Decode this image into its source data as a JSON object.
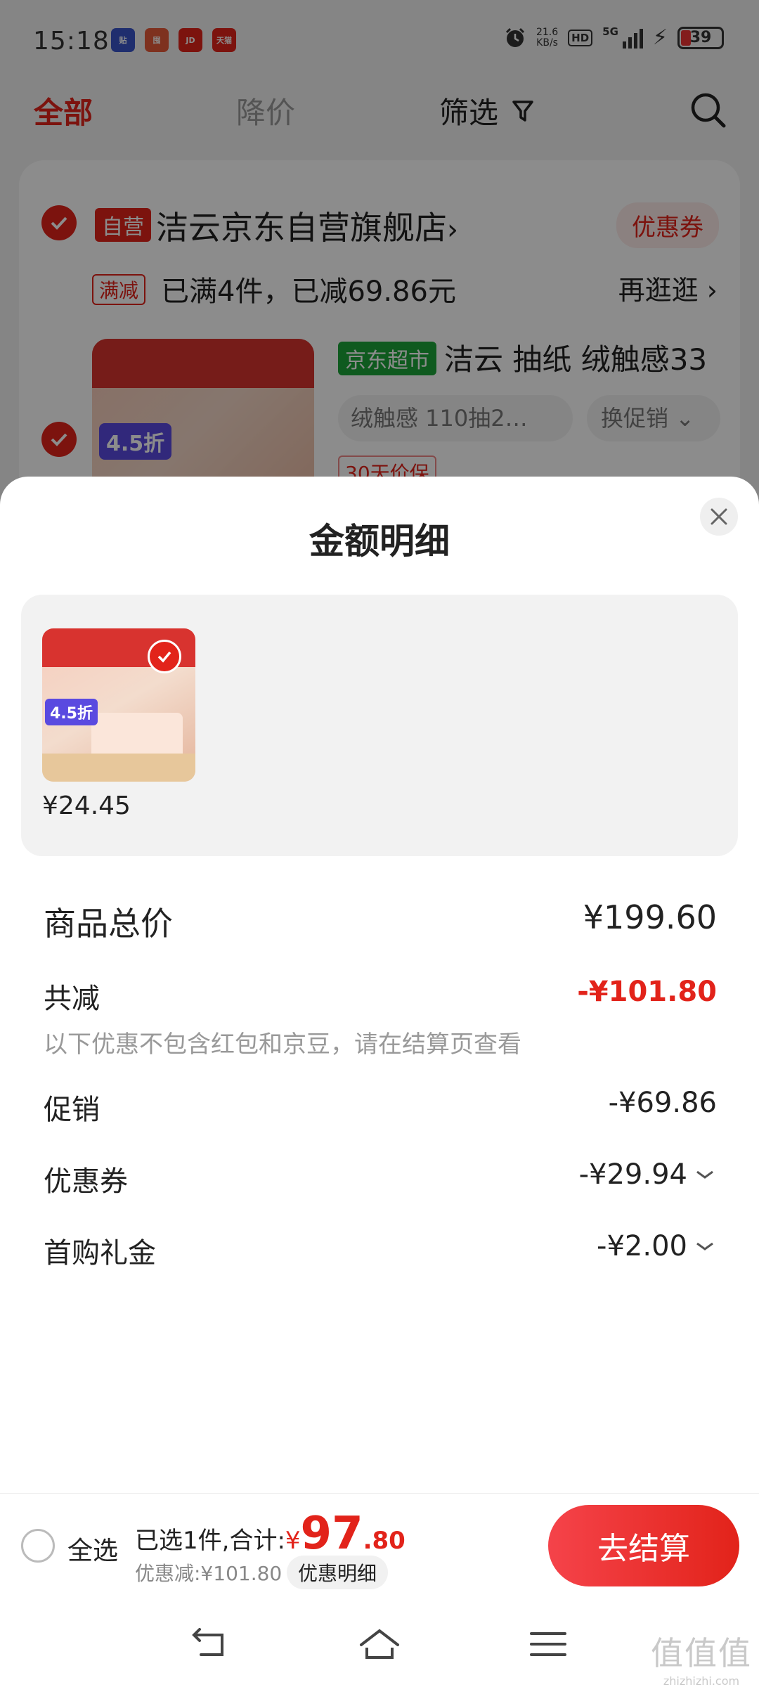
{
  "status_bar": {
    "time": "15:18",
    "apps": [
      {
        "name": "app-icon-1",
        "label": "贴",
        "color": "#3a55c8"
      },
      {
        "name": "app-icon-2",
        "label": "囤",
        "color": "#e65a3a"
      },
      {
        "name": "app-icon-3",
        "label": "JD",
        "color": "#e2231a"
      },
      {
        "name": "app-icon-4",
        "label": "天猫",
        "color": "#e2231a"
      }
    ],
    "net_speed_value": "21.6",
    "net_speed_unit": "KB/s",
    "hd": "HD",
    "network": "5G",
    "battery": "39"
  },
  "nav": {
    "tab_all": "全部",
    "tab_price_drop": "降价",
    "filter": "筛选"
  },
  "store": {
    "self_tag": "自营",
    "name": "洁云京东自营旗舰店",
    "coupon": "优惠券",
    "mj_tag": "满减",
    "mj_text": "已满4件，已减69.86元",
    "more": "再逛逛",
    "product_tag": "京东超市",
    "product_title": "洁云 抽纸 绒触感33",
    "spec": "绒触感 110抽2…",
    "promo": "换促销",
    "price_protect": "30天价保",
    "img_discount": "4.5折"
  },
  "sheet": {
    "title": "金额明细",
    "item_price": "¥24.45",
    "thumb_discount": "4.5折",
    "rows": {
      "total_label": "商品总价",
      "total_value": "¥199.60",
      "reduce_label": "共减",
      "reduce_value": "-¥101.80",
      "note": "以下优惠不包含红包和京豆，请在结算页查看",
      "promo_label": "促销",
      "promo_value": "-¥69.86",
      "coupon_label": "优惠券",
      "coupon_value": "-¥29.94",
      "gift_label": "首购礼金",
      "gift_value": "-¥2.00"
    }
  },
  "bottom": {
    "select_all": "全选",
    "summary_prefix": "已选1件,合计:",
    "currency": "¥",
    "total_int": "97",
    "total_dec": ".80",
    "discount": "优惠减:¥101.80",
    "detail": "优惠明细",
    "checkout": "去结算"
  },
  "watermark": {
    "main": "值值值",
    "sub": "zhizhizhi.com"
  },
  "colors": {
    "accent": "#e2231a",
    "jd_supermarket": "#1da43a"
  }
}
